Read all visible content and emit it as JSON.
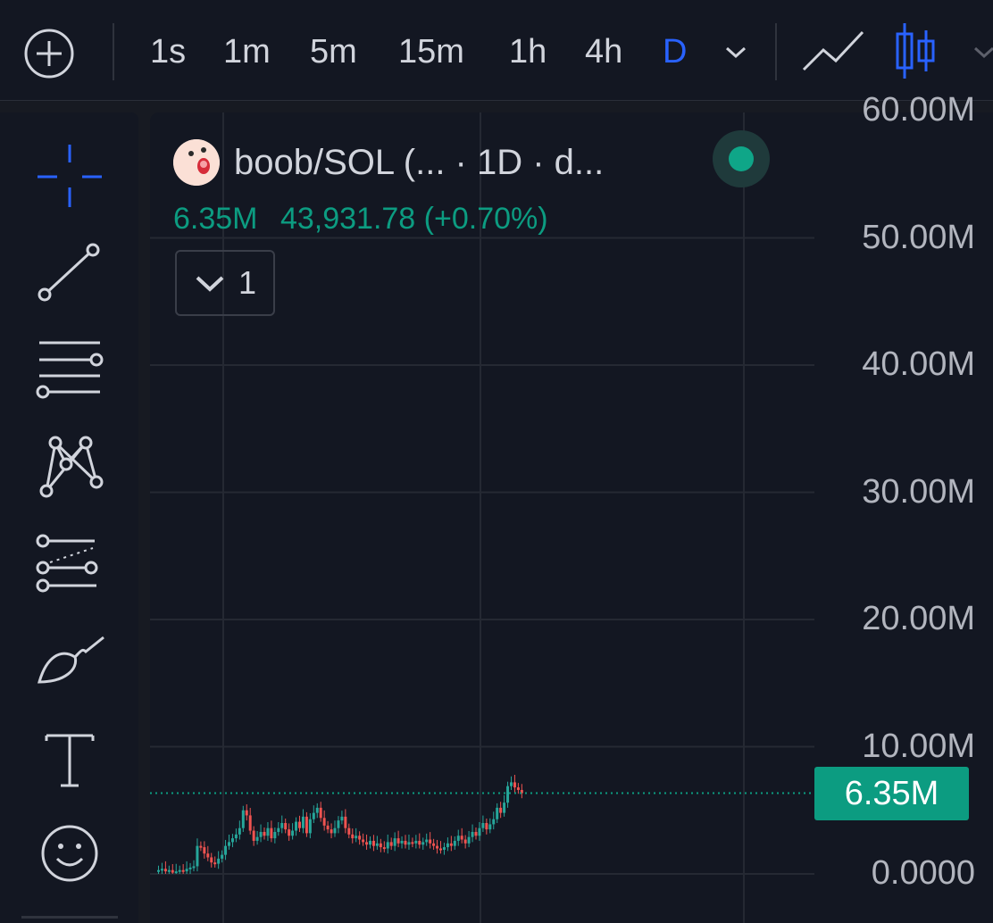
{
  "toolbar": {
    "intervals": [
      "1s",
      "1m",
      "5m",
      "15m",
      "1h",
      "4h",
      "D"
    ],
    "active_interval": "D",
    "icons": [
      "add-circle-icon",
      "chevron-down-icon",
      "line-chart-icon",
      "candles-icon",
      "chevron-down-icon"
    ]
  },
  "left_tools": [
    "crosshair-icon",
    "trend-line-icon",
    "horizontal-lines-icon",
    "pattern-icon",
    "fib-levels-icon",
    "brush-icon",
    "text-icon",
    "emoji-icon"
  ],
  "legend": {
    "title": "boob/SOL (... · 1D · d...",
    "last_value": "6.35M",
    "change": "43,931.78 (+0.70%)",
    "collapse_count": "1"
  },
  "colors": {
    "up": "#26a69a",
    "down": "#ef5350",
    "accent": "#2962ff",
    "last_price_bg": "#0c9c81"
  },
  "chart_data": {
    "type": "candlestick",
    "title": "boob/SOL (... · 1D · d...",
    "xlabel": "",
    "ylabel": "",
    "ylim": [
      0,
      61
    ],
    "y_ticks": [
      "60.00M",
      "50.00M",
      "40.00M",
      "30.00M",
      "20.00M",
      "10.00M",
      "0.0000"
    ],
    "y_tick_values": [
      60,
      50,
      40,
      30,
      20,
      10,
      0
    ],
    "last_price": 6.35,
    "last_price_label": "6.35M",
    "close_series": [
      0.3,
      0.4,
      0.2,
      0.3,
      0.1,
      0.2,
      0.3,
      0.2,
      0.4,
      0.5,
      0.6,
      2.2,
      2.1,
      1.6,
      1.3,
      0.9,
      0.8,
      1.2,
      1.5,
      2.2,
      2.5,
      2.8,
      3.1,
      3.6,
      5.0,
      4.6,
      3.4,
      2.6,
      2.9,
      3.3,
      3.0,
      3.6,
      2.8,
      3.3,
      3.6,
      4.0,
      3.5,
      3.0,
      3.4,
      4.1,
      3.6,
      4.5,
      3.2,
      4.3,
      4.8,
      5.2,
      4.4,
      3.8,
      3.5,
      3.2,
      3.6,
      4.2,
      4.5,
      3.6,
      3.1,
      2.8,
      3.0,
      2.7,
      2.5,
      2.3,
      2.6,
      2.2,
      2.4,
      2.1,
      2.0,
      2.5,
      2.2,
      2.8,
      2.4,
      2.6,
      2.3,
      2.5,
      2.4,
      2.6,
      2.3,
      2.5,
      2.7,
      2.4,
      2.2,
      2.0,
      1.9,
      2.1,
      2.4,
      2.2,
      2.6,
      3.0,
      2.7,
      2.4,
      2.9,
      3.3,
      3.0,
      3.6,
      4.0,
      3.5,
      3.9,
      4.3,
      5.2,
      4.8,
      5.6,
      6.9,
      7.2,
      6.8,
      6.6,
      6.35
    ]
  }
}
